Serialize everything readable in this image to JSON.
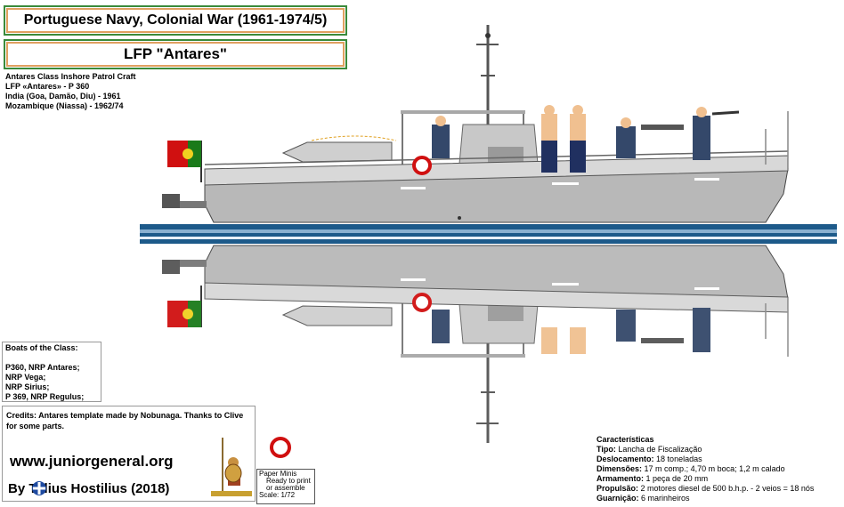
{
  "title": "Portuguese Navy, Colonial War (1961-1974/5)",
  "subtitle": "LFP \"Antares\"",
  "info_lines": [
    "Antares Class Inshore Patrol Craft",
    "LFP «Antares» - P 360",
    "India (Goa, Damão, Diu) - 1961",
    "Mozambique (Niassa) - 1962/74"
  ],
  "boats": {
    "heading": "Boats of the Class:",
    "items": [
      "P360, NRP Antares;",
      "NRP Vega;",
      "NRP Sirius;",
      "P 369, NRP Regulus;"
    ]
  },
  "credits": "Credits: Antares template made by Nobunaga. Thanks to Clive for some parts.",
  "website": "www.juniorgeneral.org",
  "author": "By  Tulius Hostilius (2018)",
  "specs": {
    "heading": "Características",
    "rows": [
      {
        "label": "Tipo:",
        "value": "Lancha de Fiscalização"
      },
      {
        "label": "Deslocamento:",
        "value": "18 toneladas"
      },
      {
        "label": "Dimensões:",
        "value": "17 m comp.; 4,70 m boca; 1,2 m calado"
      },
      {
        "label": "Armamento:",
        "value": "1 peça de 20 mm"
      },
      {
        "label": "Propulsão:",
        "value": "2 motores diesel de 500 b.h.p. - 2 veios = 18 nós"
      },
      {
        "label": "Guarnição:",
        "value": "6 marinheiros"
      }
    ]
  },
  "paper_minis": [
    "Paper Minis",
    "Ready to print",
    "or assemble",
    "Scale: 1/72"
  ],
  "colors": {
    "hull": "#b8b8b8",
    "deck": "#d8d8d8",
    "water": "#1d5a8a",
    "flag_green": "#1a7a1a",
    "flag_red": "#d01010",
    "border_green": "#3a8a3a",
    "border_orange": "#e0a060"
  }
}
